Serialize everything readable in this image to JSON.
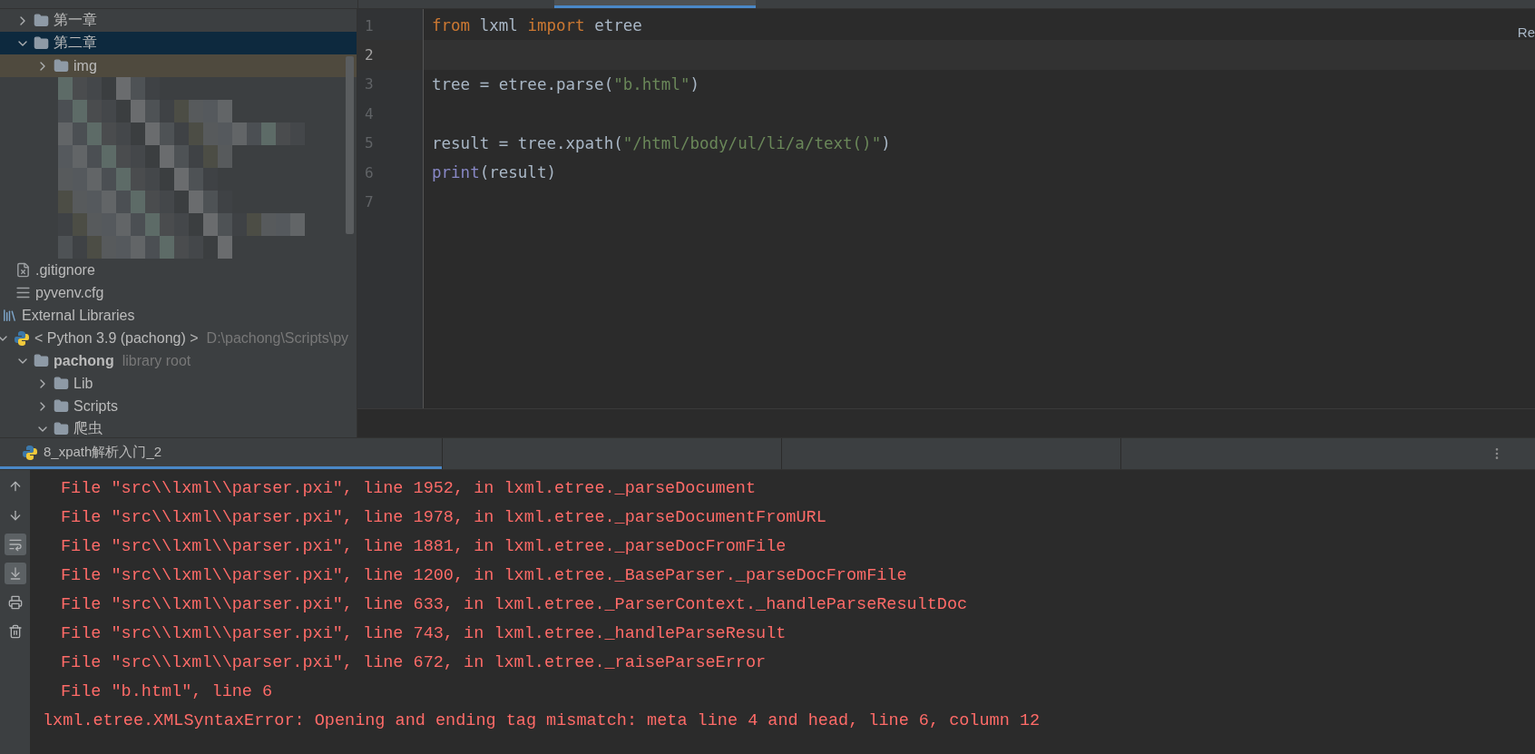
{
  "sidebar": {
    "project_items": [
      {
        "label": "第一章",
        "kind": "folder",
        "expanded": false,
        "selected": false
      },
      {
        "label": "第二章",
        "kind": "folder",
        "expanded": true,
        "selected": true,
        "children": [
          {
            "label": "img",
            "kind": "folder",
            "expanded": false,
            "selected": false,
            "highlighted": true
          },
          {
            "kind": "pixelated"
          }
        ]
      },
      {
        "label": ".gitignore",
        "kind": "ignore-file"
      },
      {
        "label": "pyvenv.cfg",
        "kind": "config-file"
      }
    ],
    "libraries": [
      {
        "label": "External Libraries",
        "kind": "library",
        "children": [
          {
            "label": "< Python 3.9 (pachong) >",
            "hint": "D:\\pachong\\Scripts\\py",
            "kind": "python",
            "expanded": true,
            "selected": false,
            "children": [
              {
                "label": "pachong",
                "hint": "library root",
                "bold": true,
                "kind": "folder",
                "expanded": true,
                "selected": false,
                "children": [
                  {
                    "label": "Lib",
                    "kind": "folder",
                    "expanded": false,
                    "selected": false
                  },
                  {
                    "label": "Scripts",
                    "kind": "folder",
                    "expanded": false,
                    "selected": false
                  },
                  {
                    "label": "爬虫",
                    "kind": "folder",
                    "expanded": true,
                    "selected": false
                  }
                ]
              }
            ]
          }
        ]
      }
    ]
  },
  "editor": {
    "corner_label": "Re",
    "lines": [
      {
        "number": "1",
        "current": false,
        "tokens": [
          {
            "kind": "keyword",
            "text": "from"
          },
          {
            "kind": "plain",
            "text": " lxml "
          },
          {
            "kind": "keyword",
            "text": "import"
          },
          {
            "kind": "plain",
            "text": " etree"
          }
        ]
      },
      {
        "number": "2",
        "current": true
      },
      {
        "number": "3",
        "current": false,
        "tokens": [
          {
            "kind": "plain",
            "text": "tree = etree.parse("
          },
          {
            "kind": "string",
            "text": "\"b.html\""
          },
          {
            "kind": "plain",
            "text": ")"
          }
        ]
      },
      {
        "number": "4",
        "current": false
      },
      {
        "number": "5",
        "current": false,
        "tokens": [
          {
            "kind": "plain",
            "text": "result = tree.xpath("
          },
          {
            "kind": "string",
            "text": "\"/html/body/ul/li/a/text()\""
          },
          {
            "kind": "plain",
            "text": ")"
          }
        ]
      },
      {
        "number": "6",
        "current": false,
        "tokens": [
          {
            "kind": "builtin",
            "text": "print"
          },
          {
            "kind": "plain",
            "text": "(result)"
          }
        ]
      },
      {
        "number": "7",
        "current": false
      }
    ]
  },
  "run_panel": {
    "tab": {
      "label": "8_xpath解析入门_2",
      "selected": true
    },
    "toolbar": [
      {
        "kind": "up",
        "selected": false
      },
      {
        "kind": "down",
        "selected": false
      },
      {
        "kind": "wrap",
        "selected": true
      },
      {
        "kind": "scroll-end",
        "selected": true
      },
      {
        "kind": "print",
        "selected": false
      },
      {
        "kind": "trash",
        "selected": false
      }
    ],
    "output": [
      {
        "kind": "trace",
        "text": "File \"src\\\\lxml\\\\parser.pxi\", line 1952, in lxml.etree._parseDocument"
      },
      {
        "kind": "trace",
        "text": "File \"src\\\\lxml\\\\parser.pxi\", line 1978, in lxml.etree._parseDocumentFromURL"
      },
      {
        "kind": "trace",
        "text": "File \"src\\\\lxml\\\\parser.pxi\", line 1881, in lxml.etree._parseDocFromFile"
      },
      {
        "kind": "trace",
        "text": "File \"src\\\\lxml\\\\parser.pxi\", line 1200, in lxml.etree._BaseParser._parseDocFromFile"
      },
      {
        "kind": "trace",
        "text": "File \"src\\\\lxml\\\\parser.pxi\", line 633, in lxml.etree._ParserContext._handleParseResultDoc"
      },
      {
        "kind": "trace",
        "text": "File \"src\\\\lxml\\\\parser.pxi\", line 743, in lxml.etree._handleParseResult"
      },
      {
        "kind": "trace",
        "text": "File \"src\\\\lxml\\\\parser.pxi\", line 672, in lxml.etree._raiseParseError"
      },
      {
        "kind": "trace",
        "text": "File \"b.html\", line 6"
      },
      {
        "kind": "error",
        "text": "lxml.etree.XMLSyntaxError: Opening and ending tag mismatch: meta line 4 and head, line 6, column 12"
      }
    ]
  }
}
